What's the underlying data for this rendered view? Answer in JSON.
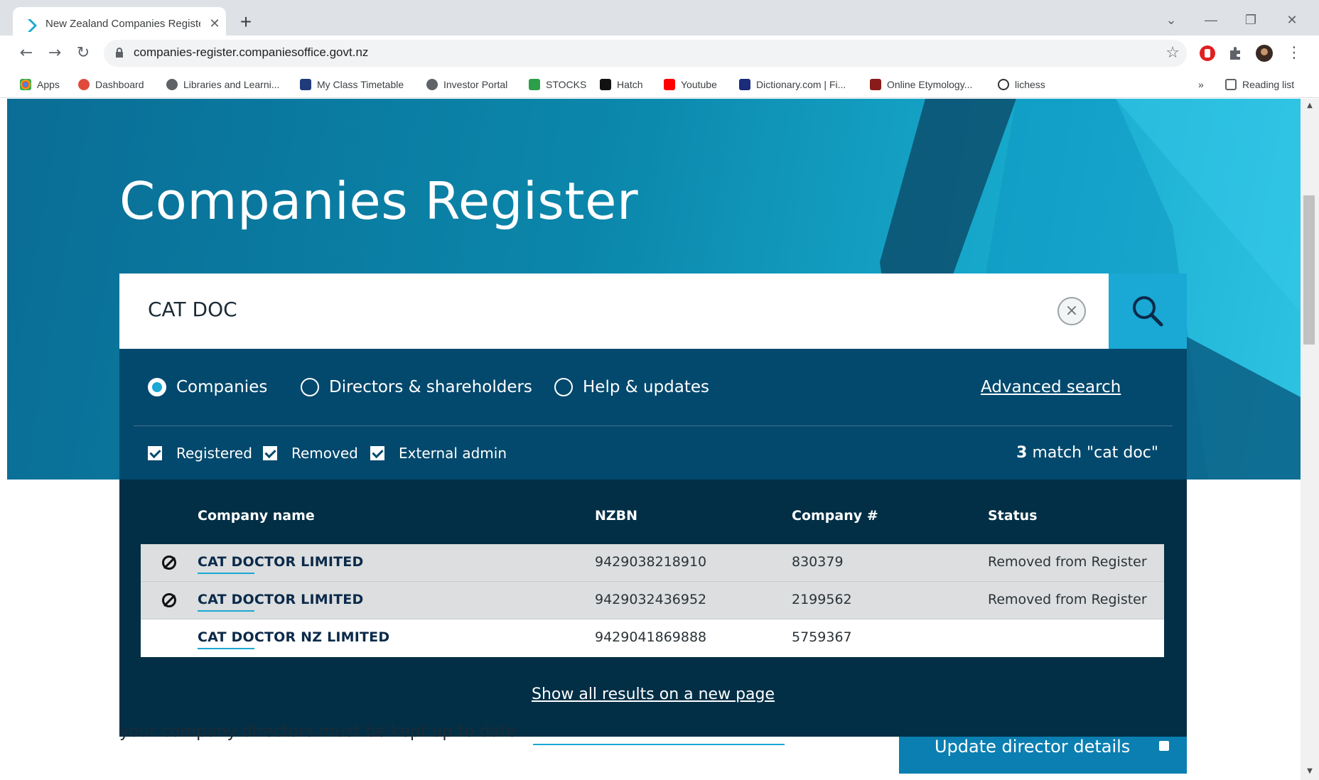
{
  "browser": {
    "tab_title": "New Zealand Companies Registe",
    "url": "companies-register.companiesoffice.govt.nz",
    "bookmarks": [
      {
        "label": "Apps",
        "color": "#e94235"
      },
      {
        "label": "Dashboard",
        "color": "#e04a3b"
      },
      {
        "label": "Libraries and Learni...",
        "color": "#5f6368"
      },
      {
        "label": "My Class Timetable",
        "color": "#1f3b7a"
      },
      {
        "label": "Investor Portal",
        "color": "#5f6368"
      },
      {
        "label": "STOCKS",
        "color": "#2c9f4b"
      },
      {
        "label": "Hatch",
        "color": "#111111"
      },
      {
        "label": "Youtube",
        "color": "#ff0000"
      },
      {
        "label": "Dictionary.com | Fi...",
        "color": "#1a2c7a"
      },
      {
        "label": "Online Etymology...",
        "color": "#8b1a1a"
      },
      {
        "label": "lichess",
        "color": "#333333"
      }
    ],
    "overflow": "»",
    "reading_list": "Reading list"
  },
  "hero": {
    "title": "Companies Register"
  },
  "search": {
    "query": "CAT DOC",
    "clear_symbol": "×"
  },
  "filters": {
    "radios": [
      {
        "label": "Companies",
        "selected": true
      },
      {
        "label": "Directors & shareholders",
        "selected": false
      },
      {
        "label": "Help & updates",
        "selected": false
      }
    ],
    "advanced_search": "Advanced search",
    "checkboxes": [
      {
        "label": "Registered",
        "checked": true
      },
      {
        "label": "Removed",
        "checked": true
      },
      {
        "label": "External admin",
        "checked": true
      }
    ],
    "match_count": "3",
    "match_text": " match \"cat doc\""
  },
  "results": {
    "headers": {
      "name": "Company name",
      "nzbn": "NZBN",
      "number": "Company #",
      "status": "Status"
    },
    "rows": [
      {
        "name": "CAT DOCTOR LIMITED",
        "nzbn": "9429038218910",
        "number": "830379",
        "status": "Removed from Register",
        "removed": true
      },
      {
        "name": "CAT DOCTOR LIMITED",
        "nzbn": "9429032436952",
        "number": "2199562",
        "status": "Removed from Register",
        "removed": true
      },
      {
        "name": "CAT DOCTOR NZ LIMITED",
        "nzbn": "9429041869888",
        "number": "5759367",
        "status": "",
        "removed": false
      }
    ],
    "show_all": "Show all results on a new page"
  },
  "below": {
    "text": "your company directors must be kept up to date",
    "button": "Update director details"
  },
  "colors": {
    "hero": "#0b87ab",
    "panel": "#03496d",
    "results_bg": "#022f46",
    "accent": "#1aa8d4"
  }
}
